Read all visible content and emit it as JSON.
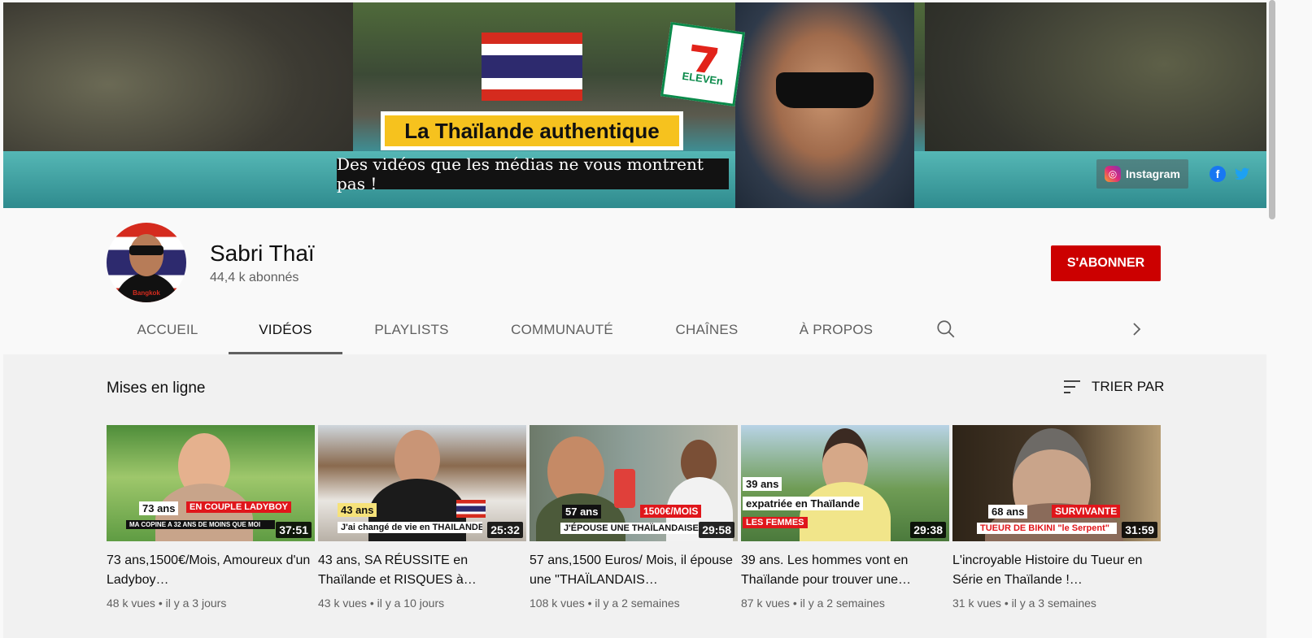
{
  "banner": {
    "headline": "La Thaïlande authentique",
    "tagline": "Des vidéos que les médias ne vous montrent pas !",
    "seven_eleven": "7",
    "seven_eleven_text": "ELEVEn",
    "social_label": "Instagram"
  },
  "channel": {
    "name": "Sabri Thaï",
    "subscribers": "44,4 k abonnés",
    "subscribe_label": "S'ABONNER",
    "avatar_text": "Bangkok"
  },
  "tabs": [
    {
      "label": "ACCUEIL"
    },
    {
      "label": "VIDÉOS"
    },
    {
      "label": "PLAYLISTS"
    },
    {
      "label": "COMMUNAUTÉ"
    },
    {
      "label": "CHAÎNES"
    },
    {
      "label": "À PROPOS"
    }
  ],
  "section": {
    "title": "Mises en ligne",
    "sort_label": "TRIER PAR"
  },
  "videos": [
    {
      "title": "73 ans,1500€/Mois, Amoureux d'un Ladyboy…",
      "views": "48 k vues",
      "age": "il y a 3 jours",
      "duration": "37:51",
      "ovl1": "73 ans",
      "ovl2": "EN COUPLE LADYBOY",
      "ovl3": "MA COPINE A 32 ANS DE MOINS QUE MOI"
    },
    {
      "title": "43 ans, SA RÉUSSITE en Thaïlande et RISQUES à…",
      "views": "43 k vues",
      "age": "il y a 10 jours",
      "duration": "25:32",
      "ovl1": "43 ans",
      "ovl2": "J'ai changé de vie en THAILANDE"
    },
    {
      "title": "57 ans,1500 Euros/ Mois, il épouse une \"THAÏLANDAIS…",
      "views": "108 k vues",
      "age": "il y a 2 semaines",
      "duration": "29:58",
      "ovl1": "57 ans",
      "ovl2": "1500€/MOIS",
      "ovl3": "J'ÉPOUSE UNE THAÏLANDAISE"
    },
    {
      "title": "39 ans. Les hommes vont en Thaïlande pour trouver une…",
      "views": "87 k vues",
      "age": "il y a 2 semaines",
      "duration": "29:38",
      "ovl1": "39 ans",
      "ovl2": "expatriée en Thaïlande",
      "ovl3": "LES FEMMES"
    },
    {
      "title": "L'incroyable Histoire du Tueur en Série en Thaïlande !…",
      "views": "31 k vues",
      "age": "il y a 3 semaines",
      "duration": "31:59",
      "ovl1": "68 ans",
      "ovl2": "SURVIVANTE",
      "ovl3": "TUEUR DE BIKINI \"le Serpent\""
    }
  ],
  "meta_separator": "•",
  "colors": {
    "subscribe": "#cc0000",
    "thai_red": "#d52b1e",
    "thai_blue": "#2d2a6e"
  }
}
